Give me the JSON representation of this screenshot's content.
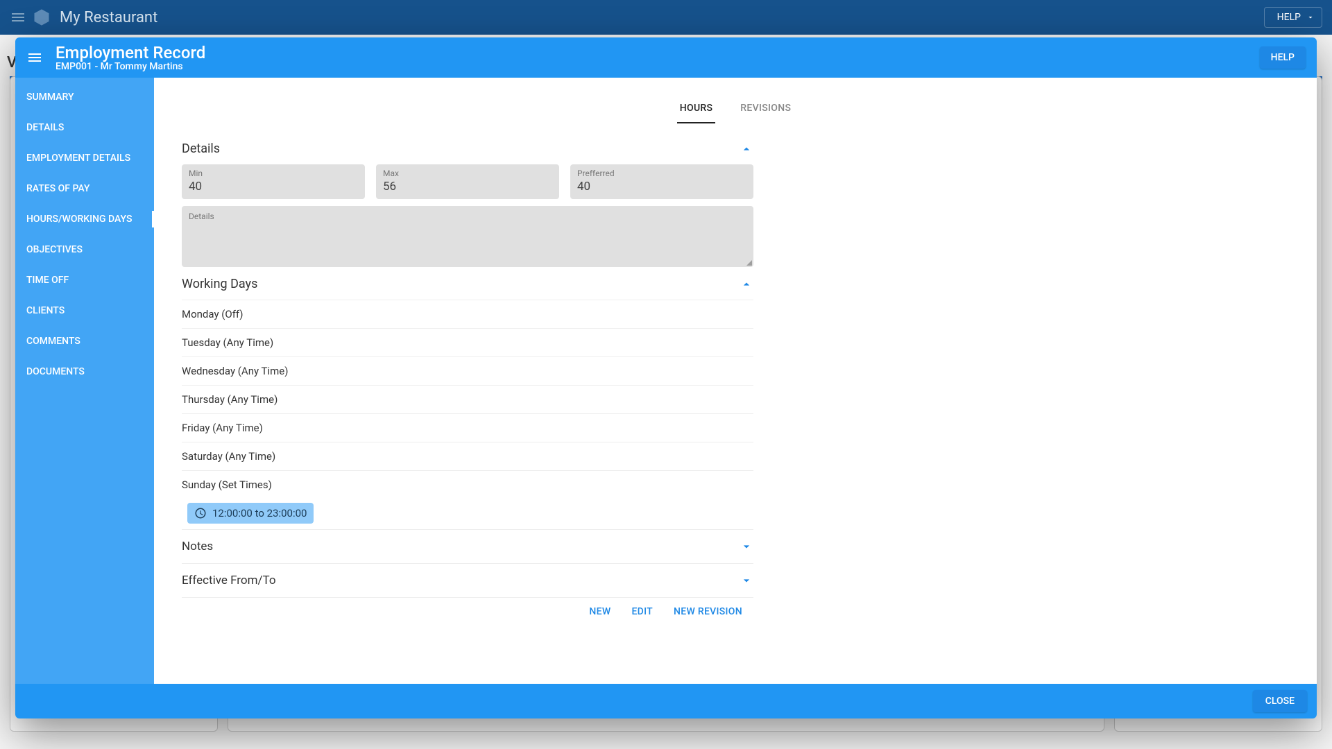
{
  "topbar": {
    "appName": "My Restaurant",
    "help": "HELP"
  },
  "modal": {
    "title": "Employment Record",
    "subtitle": "EMP001 - Mr Tommy Martins",
    "helpBtn": "HELP",
    "closeBtn": "CLOSE"
  },
  "sidebar": {
    "items": [
      {
        "label": "SUMMARY"
      },
      {
        "label": "DETAILS"
      },
      {
        "label": "EMPLOYMENT DETAILS"
      },
      {
        "label": "RATES OF PAY"
      },
      {
        "label": "HOURS/WORKING DAYS"
      },
      {
        "label": "OBJECTIVES"
      },
      {
        "label": "TIME OFF"
      },
      {
        "label": "CLIENTS"
      },
      {
        "label": "COMMENTS"
      },
      {
        "label": "DOCUMENTS"
      }
    ],
    "activeIndex": 4
  },
  "tabs": {
    "items": [
      {
        "label": "HOURS"
      },
      {
        "label": "REVISIONS"
      }
    ],
    "activeIndex": 0
  },
  "details": {
    "heading": "Details",
    "minLabel": "Min",
    "minValue": "40",
    "maxLabel": "Max",
    "maxValue": "56",
    "prefLabel": "Prefferred",
    "prefValue": "40",
    "detailsLabel": "Details"
  },
  "workingDays": {
    "heading": "Working Days",
    "items": [
      "Monday (Off)",
      "Tuesday (Any Time)",
      "Wednesday (Any Time)",
      "Thursday (Any Time)",
      "Friday (Any Time)",
      "Saturday (Any Time)",
      "Sunday (Set Times)"
    ],
    "chip": "12:00:00 to 23:00:00"
  },
  "notes": {
    "heading": "Notes"
  },
  "effective": {
    "heading": "Effective From/To"
  },
  "actions": {
    "new": "NEW",
    "edit": "EDIT",
    "newRevision": "NEW REVISION"
  }
}
